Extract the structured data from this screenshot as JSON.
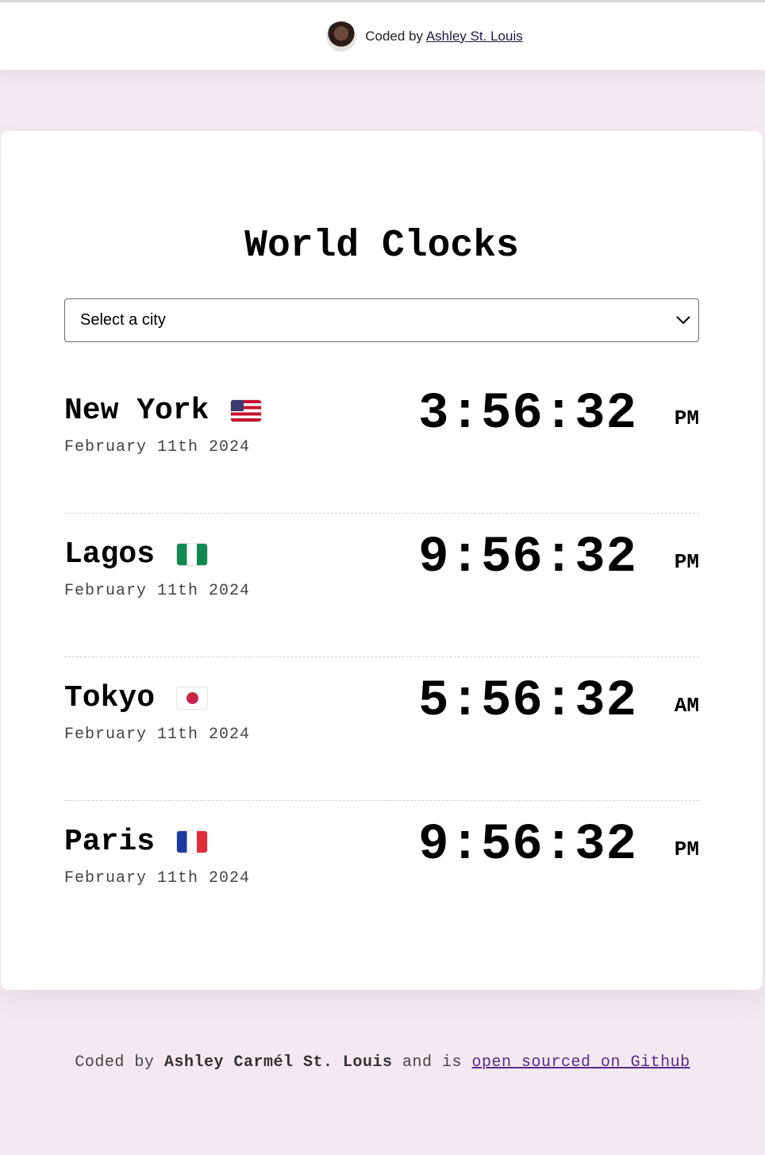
{
  "header": {
    "coded_by_prefix": "Coded by",
    "author_link": "Ashley St. Louis"
  },
  "main": {
    "title": "World Clocks",
    "city_select": {
      "selected": "Select a city"
    },
    "cities": [
      {
        "name": "New York",
        "flag": "us-flag-icon",
        "date": "February 11th 2024",
        "time": "3:56:32",
        "ampm": "PM"
      },
      {
        "name": "Lagos",
        "flag": "ng-flag-icon",
        "date": "February 11th 2024",
        "time": "9:56:32",
        "ampm": "PM"
      },
      {
        "name": "Tokyo",
        "flag": "jp-flag-icon",
        "date": "February 11th 2024",
        "time": "5:56:32",
        "ampm": "AM"
      },
      {
        "name": "Paris",
        "flag": "fr-flag-icon",
        "date": "February 11th 2024",
        "time": "9:56:32",
        "ampm": "PM"
      }
    ]
  },
  "footer": {
    "prefix": "Coded by",
    "author": "Ashley Carmél St. Louis",
    "middle": "and is",
    "link": "open sourced on Github"
  },
  "colors": {
    "page_background": "#f5e9f1",
    "card_background": "#ffffff",
    "footer_link": "#5a2a8a"
  }
}
